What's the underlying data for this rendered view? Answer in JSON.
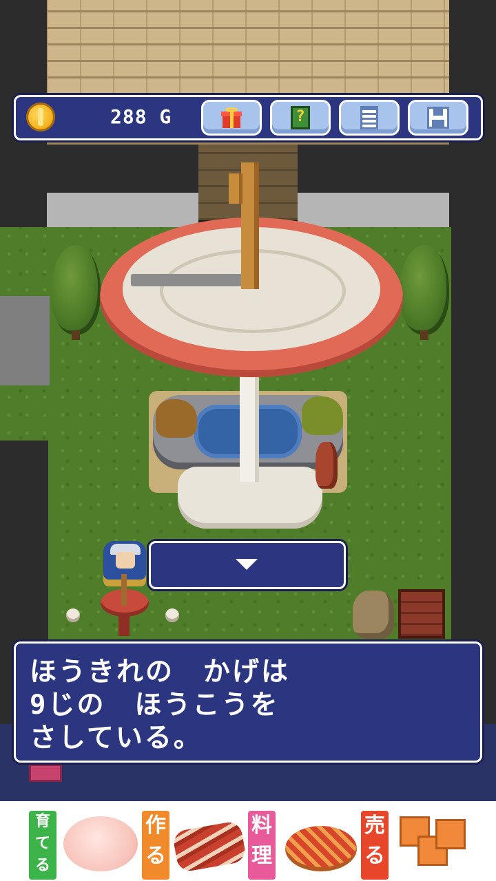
{
  "hud": {
    "gold": "288 G",
    "buttons": [
      {
        "name": "present",
        "icon": "gift-icon"
      },
      {
        "name": "hint",
        "icon": "hint-book-icon"
      },
      {
        "name": "list",
        "icon": "list-icon"
      },
      {
        "name": "save",
        "icon": "save-floppy-icon"
      }
    ]
  },
  "dialog": {
    "lines": [
      "ほうきれの　かげは",
      "9じの　ほうこうを",
      "さしている。"
    ],
    "next_icon": "down-arrow-icon"
  },
  "ad": {
    "tags": [
      "育てる",
      "作る",
      "料理",
      "売る"
    ],
    "colors": {
      "raise": "#3cb44a",
      "make": "#f08a2a",
      "cook": "#e85a9a",
      "sell": "#e8462a"
    }
  },
  "colors": {
    "panel": "#2c3680",
    "panel_border": "#ffffff",
    "button": "#a8c4ec"
  }
}
